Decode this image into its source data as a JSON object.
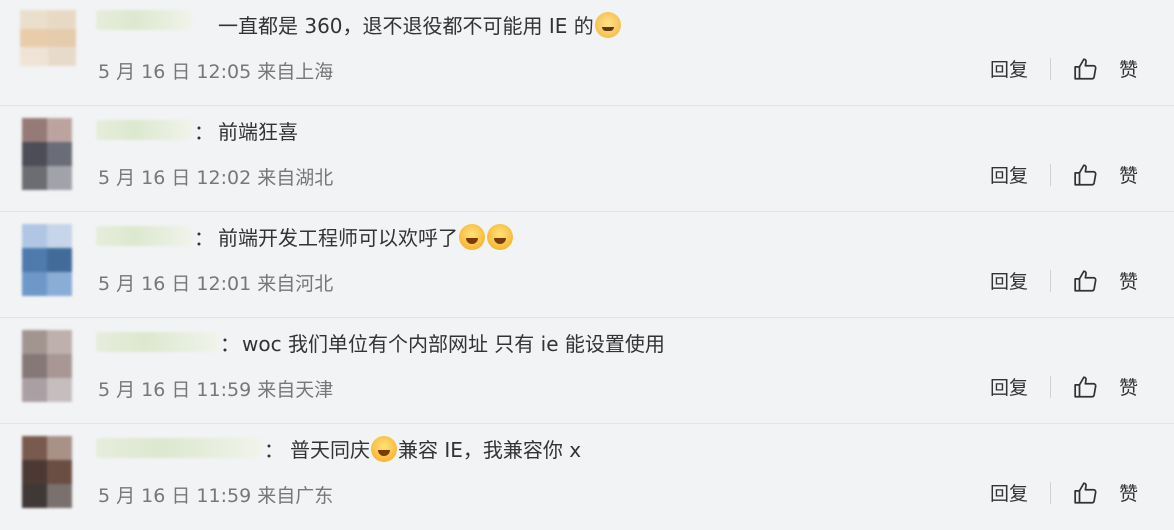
{
  "comments": [
    {
      "text": "一直都是 360，退不退役都不可能用 IE 的",
      "emoji": "dog-emoji",
      "time": "5 月 16 日 12:05 来自上海",
      "has_colon": false,
      "reply_label": "回复",
      "like_label": "赞"
    },
    {
      "text": "前端狂喜",
      "time": "5 月 16 日 12:02 来自湖北",
      "has_colon": true,
      "reply_label": "回复",
      "like_label": "赞"
    },
    {
      "text": "前端开发工程师可以欢呼了",
      "emoji": "laugh-cry-emoji",
      "time": "5 月 16 日 12:01 来自河北",
      "has_colon": true,
      "reply_label": "回复",
      "like_label": "赞"
    },
    {
      "text": "woc 我们单位有个内部网址 只有 ie 能设置使用",
      "time": "5 月 16 日 11:59 来自天津",
      "has_colon": true,
      "reply_label": "回复",
      "like_label": "赞"
    },
    {
      "text_before": "普天同庆",
      "text_after": "兼容 IE，我兼容你 x",
      "emoji": "crying-emoji",
      "time": "5 月 16 日 11:59 来自广东",
      "has_colon": true,
      "reply_label": "回复",
      "like_label": "赞"
    }
  ],
  "colon_char": "："
}
